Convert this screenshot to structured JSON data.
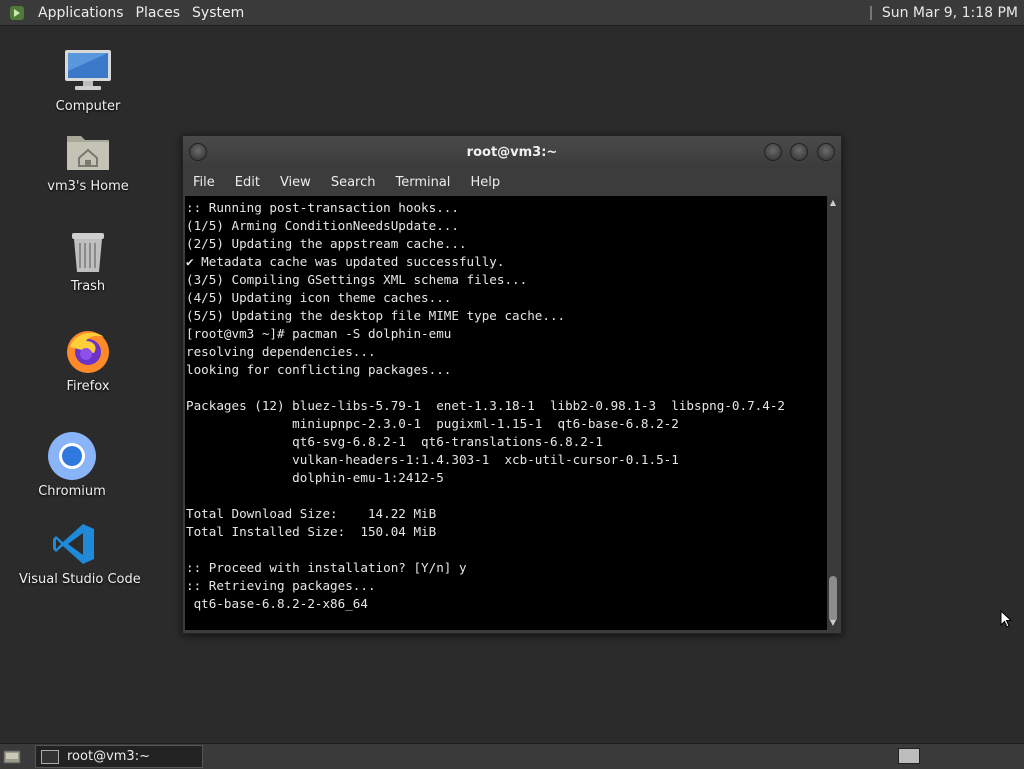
{
  "top_panel": {
    "menus": [
      "Applications",
      "Places",
      "System"
    ],
    "clock": "Sun Mar 9, 1:18 PM"
  },
  "desktop_icons": [
    {
      "label": "Computer",
      "icon": "computer-icon"
    },
    {
      "label": "vm3's Home",
      "icon": "home-folder-icon"
    },
    {
      "label": "Trash",
      "icon": "trash-icon"
    },
    {
      "label": "Firefox",
      "icon": "firefox-icon"
    },
    {
      "label": "Chromium",
      "icon": "chromium-icon"
    },
    {
      "label": "Visual Studio Code",
      "icon": "vscode-icon"
    }
  ],
  "terminal": {
    "title": "root@vm3:~",
    "menu": [
      "File",
      "Edit",
      "View",
      "Search",
      "Terminal",
      "Help"
    ],
    "output": ":: Running post-transaction hooks...\n(1/5) Arming ConditionNeedsUpdate...\n(2/5) Updating the appstream cache...\n✔ Metadata cache was updated successfully.\n(3/5) Compiling GSettings XML schema files...\n(4/5) Updating icon theme caches...\n(5/5) Updating the desktop file MIME type cache...\n[root@vm3 ~]# pacman -S dolphin-emu\nresolving dependencies...\nlooking for conflicting packages...\n\nPackages (12) bluez-libs-5.79-1  enet-1.3.18-1  libb2-0.98.1-3  libspng-0.7.4-2\n              miniupnpc-2.3.0-1  pugixml-1.15-1  qt6-base-6.8.2-2\n              qt6-svg-6.8.2-1  qt6-translations-6.8.2-1\n              vulkan-headers-1:1.4.303-1  xcb-util-cursor-0.1.5-1\n              dolphin-emu-1:2412-5\n\nTotal Download Size:    14.22 MiB\nTotal Installed Size:  150.04 MiB\n\n:: Proceed with installation? [Y/n] y\n:: Retrieving packages...\n qt6-base-6.8.2-2-x86_64"
  },
  "taskbar": {
    "task_label": "root@vm3:~"
  }
}
